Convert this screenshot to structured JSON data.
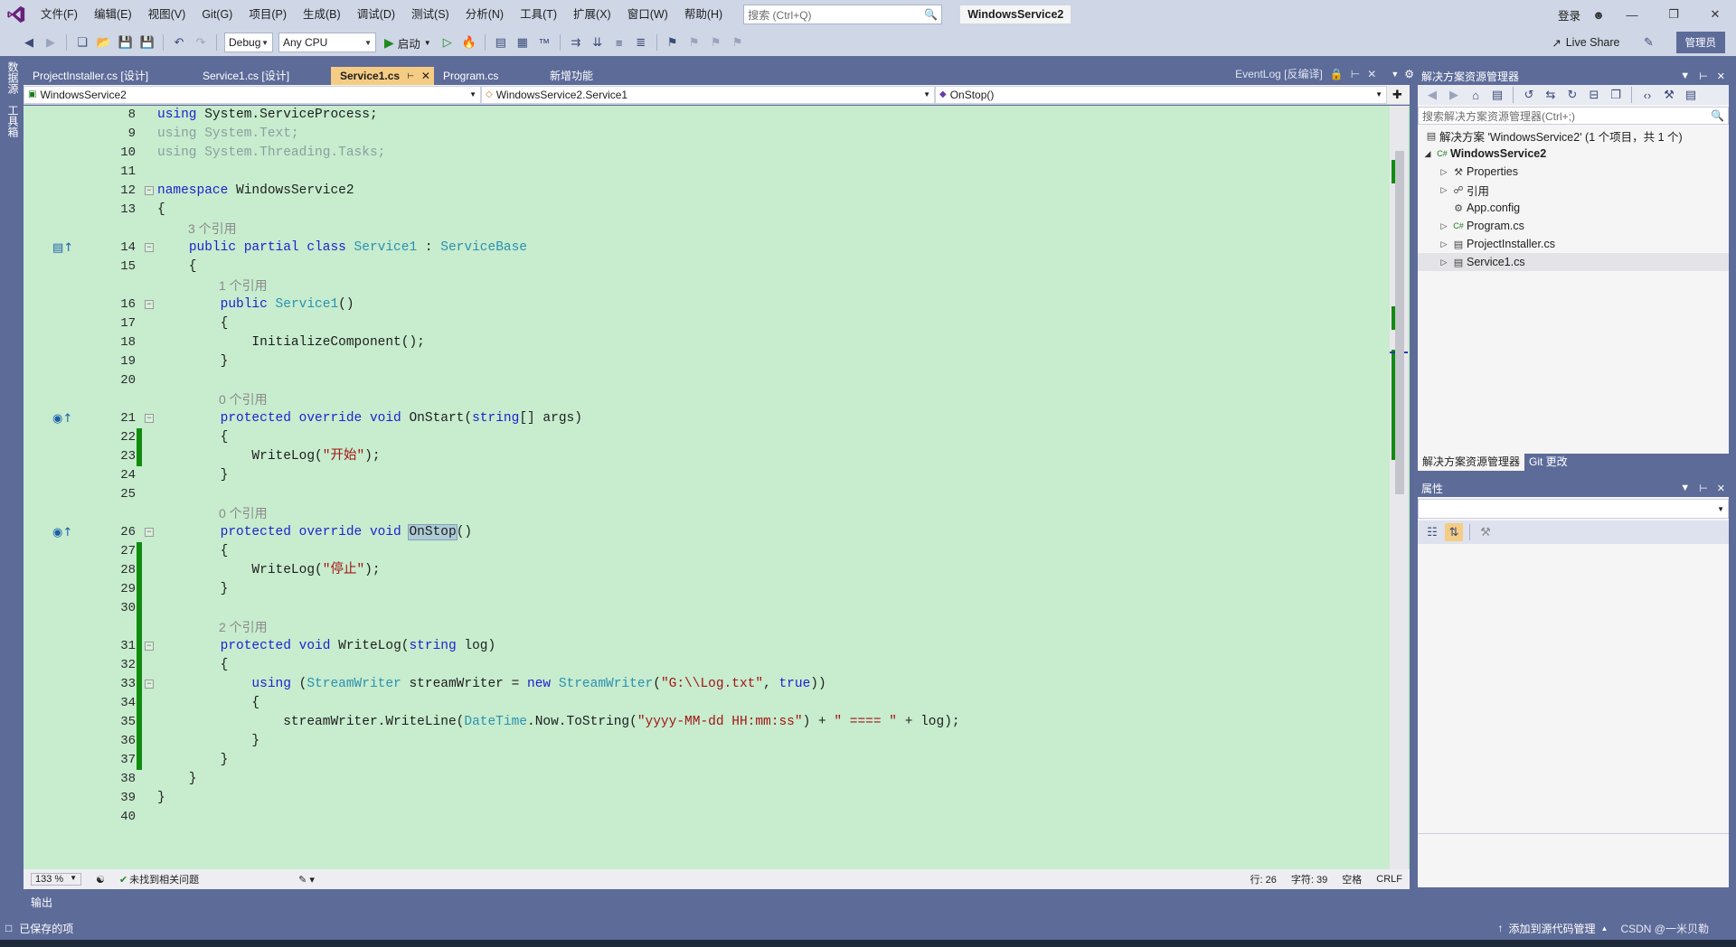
{
  "menu": [
    "文件(F)",
    "编辑(E)",
    "视图(V)",
    "Git(G)",
    "项目(P)",
    "生成(B)",
    "调试(D)",
    "测试(S)",
    "分析(N)",
    "工具(T)",
    "扩展(X)",
    "窗口(W)",
    "帮助(H)"
  ],
  "search": {
    "placeholder": "搜索 (Ctrl+Q)"
  },
  "solution_name": "WindowsService2",
  "title_right": {
    "login": "登录"
  },
  "toolbar": {
    "config": "Debug",
    "platform": "Any CPU",
    "start_label": "启动",
    "liveshare": "Live Share",
    "admin": "管理员"
  },
  "left_strip": [
    "数据源",
    "工具箱"
  ],
  "doc_tabs": [
    {
      "label": "ProjectInstaller.cs [设计]"
    },
    {
      "label": "Service1.cs [设计]"
    },
    {
      "label": "Service1.cs"
    },
    {
      "label": "Program.cs"
    },
    {
      "label": "新增功能"
    }
  ],
  "doc_tab_right": {
    "label": "EventLog [反编译]"
  },
  "nav": {
    "project": "WindowsService2",
    "type": "WindowsService2.Service1",
    "member": "OnStop()"
  },
  "editor": {
    "lenses": [
      "3 个引用",
      "1 个引用",
      "0 个引用",
      "0 个引用",
      "2 个引用"
    ]
  },
  "editor_status": {
    "zoom": "133 %",
    "issues": "未找到相关问题",
    "line": "行: 26",
    "char": "字符: 39",
    "space": "空格",
    "eol": "CRLF"
  },
  "output_tab": "输出",
  "statusbar": {
    "saved": "已保存的项",
    "source_control": "添加到源代码管理",
    "watermark": "CSDN @一米贝勒"
  },
  "solution_explorer": {
    "title": "解决方案资源管理器",
    "search_placeholder": "搜索解决方案资源管理器(Ctrl+;)",
    "solution_label": "解决方案 'WindowsService2' (1 个项目，共 1 个)",
    "project": "WindowsService2",
    "items": [
      {
        "label": "Properties",
        "icon": "wrench-icon"
      },
      {
        "label": "引用",
        "icon": "references-icon"
      },
      {
        "label": "App.config",
        "icon": "config-icon"
      },
      {
        "label": "Program.cs",
        "icon": "csharp-file-icon"
      },
      {
        "label": "ProjectInstaller.cs",
        "icon": "csharp-file-icon"
      },
      {
        "label": "Service1.cs",
        "icon": "csharp-file-icon"
      }
    ],
    "bottom_tabs": [
      "解决方案资源管理器",
      "Git 更改"
    ]
  },
  "properties": {
    "title": "属性"
  },
  "colors": {
    "chrome": "#5d6b99",
    "editor_bg": "#c7ecce",
    "active_tab": "#f5cc84",
    "keyword": "#1f1fd0",
    "type": "#2b91af",
    "string": "#a31515",
    "change_bar": "#108c10"
  }
}
